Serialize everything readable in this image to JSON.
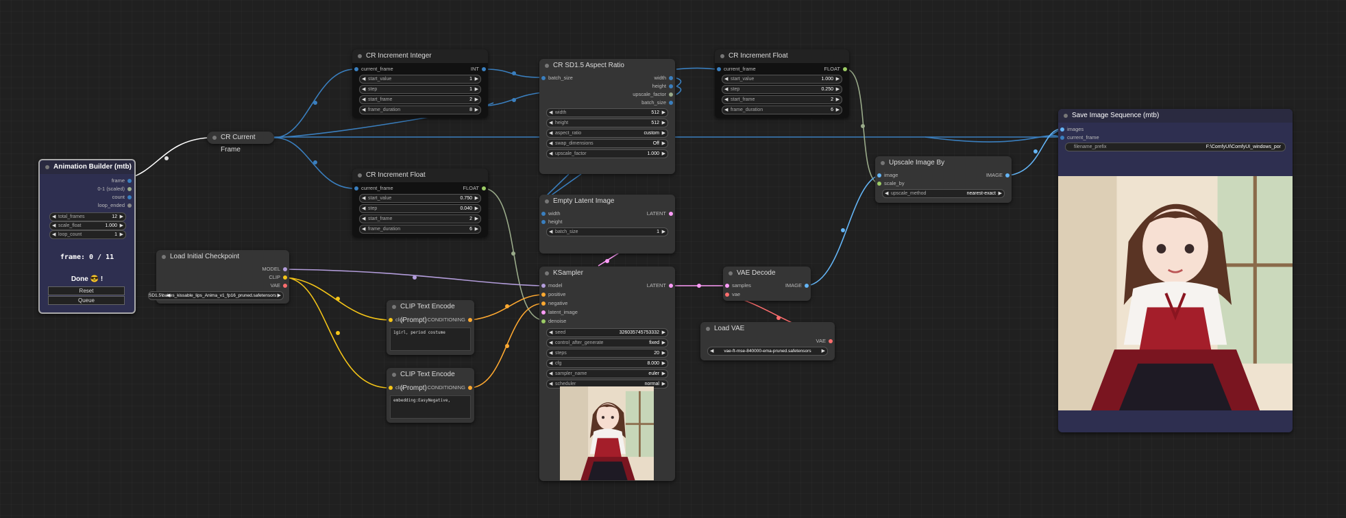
{
  "nodes": {
    "animation_builder": {
      "title": "Animation Builder (mtb)",
      "outputs": [
        "frame",
        "0-1 (scaled)",
        "count",
        "loop_ended"
      ],
      "widgets": [
        {
          "label": "total_frames",
          "value": "12"
        },
        {
          "label": "scale_float",
          "value": "1.000"
        },
        {
          "label": "loop_count",
          "value": "1"
        }
      ],
      "frame_text": "frame: 0 / 11",
      "done_text": "Done 😎 !",
      "reset_label": "Reset",
      "queue_label": "Queue"
    },
    "current_frame": {
      "title": "CR Current Frame"
    },
    "increment_integer": {
      "title": "CR Increment Integer",
      "input": "current_frame",
      "output": "INT",
      "widgets": [
        {
          "label": "start_value",
          "value": "1"
        },
        {
          "label": "step",
          "value": "1"
        },
        {
          "label": "start_frame",
          "value": "2"
        },
        {
          "label": "frame_duration",
          "value": "8"
        }
      ]
    },
    "increment_float_a": {
      "title": "CR Increment Float",
      "input": "current_frame",
      "output": "FLOAT",
      "widgets": [
        {
          "label": "start_value",
          "value": "0.750"
        },
        {
          "label": "step",
          "value": "0.040"
        },
        {
          "label": "start_frame",
          "value": "2"
        },
        {
          "label": "frame_duration",
          "value": "6"
        }
      ]
    },
    "increment_float_b": {
      "title": "CR Increment Float",
      "input": "current_frame",
      "output": "FLOAT",
      "widgets": [
        {
          "label": "start_value",
          "value": "1.000"
        },
        {
          "label": "step",
          "value": "0.250"
        },
        {
          "label": "start_frame",
          "value": "2"
        },
        {
          "label": "frame_duration",
          "value": "6"
        }
      ]
    },
    "aspect_ratio": {
      "title": "CR SD1.5 Aspect Ratio",
      "input": "batch_size",
      "outputs": [
        "width",
        "height",
        "upscale_factor",
        "batch_size"
      ],
      "widgets": [
        {
          "label": "width",
          "value": "512"
        },
        {
          "label": "height",
          "value": "512"
        },
        {
          "label": "aspect_ratio",
          "value": "custom"
        },
        {
          "label": "swap_dimensions",
          "value": "Off"
        },
        {
          "label": "upscale_factor",
          "value": "1.000"
        }
      ]
    },
    "empty_latent": {
      "title": "Empty Latent Image",
      "inputs": [
        "width",
        "height"
      ],
      "output": "LATENT",
      "widgets": [
        {
          "label": "batch_size",
          "value": "1"
        }
      ]
    },
    "load_checkpoint": {
      "title": "Load Initial Checkpoint",
      "outputs": [
        "MODEL",
        "CLIP",
        "VAE"
      ],
      "ckpt_value": "SD1.5\\babes_kissable_lips_Anima_v1_fp16_pruned.safetensors"
    },
    "clip_pos": {
      "title": "CLIP Text Encode (Prompt)",
      "input": "clip",
      "output": "CONDITIONING",
      "text": "1girl, period costume"
    },
    "clip_neg": {
      "title": "CLIP Text Encode (Prompt)",
      "input": "clip",
      "output": "CONDITIONING",
      "text": "embedding:EasyNegative,"
    },
    "ksampler": {
      "title": "KSampler",
      "inputs": [
        "model",
        "positive",
        "negative",
        "latent_image",
        "denoise"
      ],
      "output": "LATENT",
      "widgets": [
        {
          "label": "seed",
          "value": "326035745753332"
        },
        {
          "label": "control_after_generate",
          "value": "fixed"
        },
        {
          "label": "steps",
          "value": "20"
        },
        {
          "label": "cfg",
          "value": "8.000"
        },
        {
          "label": "sampler_name",
          "value": "euler"
        },
        {
          "label": "scheduler",
          "value": "normal"
        }
      ]
    },
    "vae_decode": {
      "title": "VAE Decode",
      "inputs": [
        "samples",
        "vae"
      ],
      "output": "IMAGE"
    },
    "load_vae": {
      "title": "Load VAE",
      "output": "VAE",
      "vae_value": "vae-ft-mse-840000-ema-pruned.safetensors"
    },
    "upscale": {
      "title": "Upscale Image By",
      "inputs": [
        "image",
        "scale_by"
      ],
      "output": "IMAGE",
      "widgets": [
        {
          "label": "upscale_method",
          "value": "nearest-exact"
        }
      ]
    },
    "save_seq": {
      "title": "Save Image Sequence (mtb)",
      "inputs": [
        "images",
        "current_frame"
      ],
      "widgets": [
        {
          "label": "filename_prefix",
          "value": "F:\\ComfyUI\\ComfyUI_windows_por"
        }
      ]
    }
  },
  "colors": {
    "background": "#202020",
    "node": "#353535",
    "int_wire": "#3a7fbf",
    "float_wire": "#9aab8a",
    "clip_wire": "#f5c518",
    "model_wire": "#b39ddb",
    "latent_wire": "#ff9cf9",
    "image_wire": "#64b5f6",
    "vae_wire": "#ff6e6e",
    "conditioning_wire": "#ffa931"
  }
}
